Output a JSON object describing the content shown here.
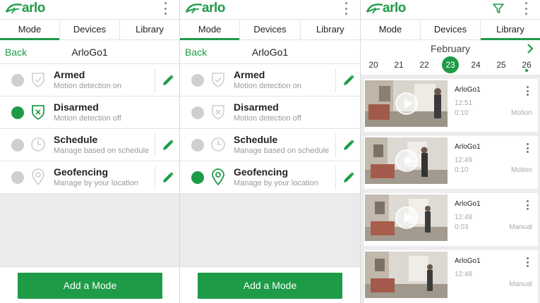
{
  "brand": {
    "name": "arlo",
    "color": "#1e9b47"
  },
  "tabs": [
    "Mode",
    "Devices",
    "Library"
  ],
  "mode_screen": {
    "back_label": "Back",
    "device_title": "ArloGo1",
    "add_button": "Add a Mode"
  },
  "panel1": {
    "active_tab": "Mode",
    "modes": [
      {
        "name": "Armed",
        "desc": "Motion detection on",
        "icon": "shield-check-icon",
        "selected": false,
        "editable": true
      },
      {
        "name": "Disarmed",
        "desc": "Motion detection off",
        "icon": "shield-x-icon",
        "selected": true,
        "editable": false
      },
      {
        "name": "Schedule",
        "desc": "Manage based on schedule",
        "icon": "clock-icon",
        "selected": false,
        "editable": true
      },
      {
        "name": "Geofencing",
        "desc": "Manage by your location",
        "icon": "location-pin-icon",
        "selected": false,
        "editable": true
      }
    ]
  },
  "panel2": {
    "active_tab": "Mode",
    "modes": [
      {
        "name": "Armed",
        "desc": "Motion detection on",
        "icon": "shield-check-icon",
        "selected": false,
        "editable": true
      },
      {
        "name": "Disarmed",
        "desc": "Motion detection off",
        "icon": "shield-x-icon",
        "selected": false,
        "editable": false
      },
      {
        "name": "Schedule",
        "desc": "Manage based on schedule",
        "icon": "clock-icon",
        "selected": false,
        "editable": true
      },
      {
        "name": "Geofencing",
        "desc": "Manage by your location",
        "icon": "location-pin-icon",
        "selected": true,
        "editable": true
      }
    ]
  },
  "library": {
    "active_tab": "Library",
    "month": "February",
    "dates": [
      "20",
      "21",
      "22",
      "23",
      "24",
      "25",
      "26"
    ],
    "selected_date": "23",
    "dates_with_dot": [
      "26"
    ],
    "clips": [
      {
        "camera": "ArloGo1",
        "time": "12:51",
        "duration": "0:10",
        "trigger": "Motion"
      },
      {
        "camera": "ArloGo1",
        "time": "12:49",
        "duration": "0:10",
        "trigger": "Motion"
      },
      {
        "camera": "ArloGo1",
        "time": "12:48",
        "duration": "0:03",
        "trigger": "Manual"
      },
      {
        "camera": "ArloGo1",
        "time": "12:48",
        "duration": "",
        "trigger": "Manual"
      }
    ]
  }
}
